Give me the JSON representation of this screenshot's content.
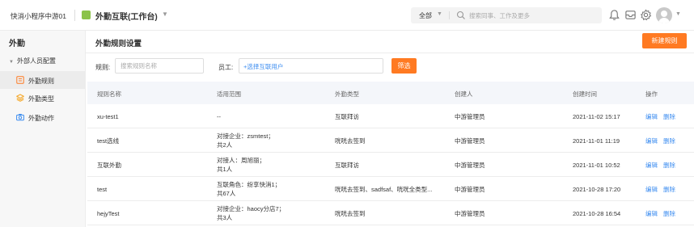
{
  "header": {
    "org_name": "快消小程序中游01",
    "app_title": "外勤互联(工作台)",
    "search_scope": "全部",
    "search_placeholder": "搜索同事、工作及更多"
  },
  "sidebar": {
    "title": "外勤",
    "group_label": "外部人员配置",
    "items": [
      {
        "label": "外勤规则",
        "icon": "rule-icon",
        "active": true
      },
      {
        "label": "外勤类型",
        "icon": "layers-icon",
        "active": false
      },
      {
        "label": "外勤动作",
        "icon": "camera-icon",
        "active": false
      }
    ]
  },
  "main": {
    "title": "外勤规则设置",
    "new_button": "新建规则",
    "filter": {
      "rule_label": "规则:",
      "rule_placeholder": "搜索规则名称",
      "employee_label": "员工:",
      "employee_select": "+选择互联用户",
      "filter_button": "筛选"
    }
  },
  "table": {
    "headers": [
      "规则名称",
      "适用范围",
      "外勤类型",
      "创建人",
      "创建时间",
      "操作"
    ],
    "rows": [
      {
        "name": "xu-test1",
        "scope1": "--",
        "scope2": "",
        "type": "互联拜访",
        "creator": "中游管理员",
        "time": "2021-11-02 15:17",
        "edit": "编辑",
        "del": "删除"
      },
      {
        "name": "test选线",
        "scope1": "对接企业：zsmtest；",
        "scope2": "共2人",
        "type": "咣咣去签到",
        "creator": "中游管理员",
        "time": "2021-11-01 11:19",
        "edit": "编辑",
        "del": "删除"
      },
      {
        "name": "互联外勤",
        "scope1": "对接人：周旭丽；",
        "scope2": "共1人",
        "type": "互联拜访",
        "creator": "中游管理员",
        "time": "2021-11-01 10:52",
        "edit": "编辑",
        "del": "删除"
      },
      {
        "name": "test",
        "scope1": "互联角色：纷享快消1；",
        "scope2": "共67人",
        "type": "咣咣去签到、sadfsaf、咣咣全类型...",
        "creator": "中游管理员",
        "time": "2021-10-28 17:20",
        "edit": "编辑",
        "del": "删除"
      },
      {
        "name": "hejyTest",
        "scope1": "对接企业：haocy分店7；",
        "scope2": "共3人",
        "type": "咣咣去签到",
        "creator": "中游管理员",
        "time": "2021-10-28 16:54",
        "edit": "编辑",
        "del": "删除"
      }
    ]
  },
  "colors": {
    "accent": "#ff7a22",
    "link": "#3b8cf0",
    "app_icon": "#8bc34a"
  }
}
